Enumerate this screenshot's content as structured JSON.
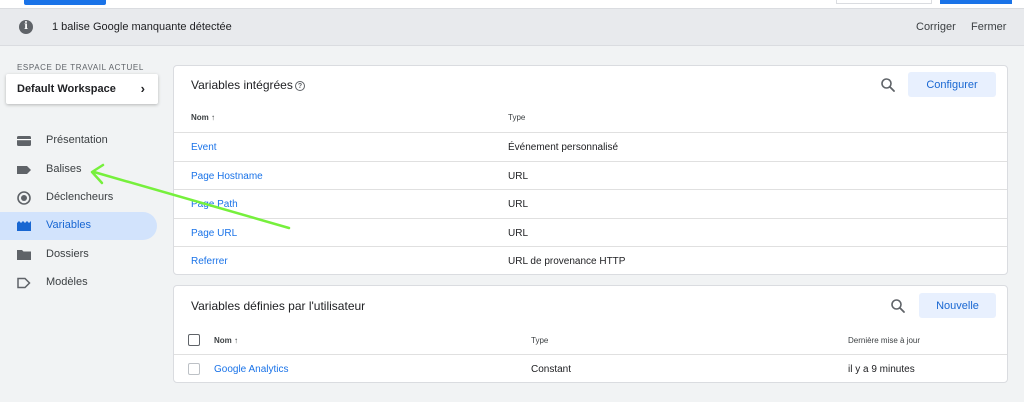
{
  "notification": {
    "message": "1 balise Google manquante détectée",
    "fix_label": "Corriger",
    "close_label": "Fermer"
  },
  "workspace": {
    "section_label": "ESPACE DE TRAVAIL ACTUEL",
    "name": "Default Workspace"
  },
  "sidebar": {
    "items": [
      {
        "label": "Présentation",
        "icon": "overview-icon"
      },
      {
        "label": "Balises",
        "icon": "tag-icon"
      },
      {
        "label": "Déclencheurs",
        "icon": "trigger-icon"
      },
      {
        "label": "Variables",
        "icon": "variables-icon",
        "active": true
      },
      {
        "label": "Dossiers",
        "icon": "folder-icon"
      },
      {
        "label": "Modèles",
        "icon": "template-icon"
      }
    ]
  },
  "builtin": {
    "title": "Variables intégrées",
    "configure_label": "Configurer",
    "columns": {
      "name": "Nom",
      "sort_arrow": "↑",
      "type": "Type"
    },
    "rows": [
      {
        "name": "Event",
        "type": "Événement personnalisé"
      },
      {
        "name": "Page Hostname",
        "type": "URL"
      },
      {
        "name": "Page Path",
        "type": "URL"
      },
      {
        "name": "Page URL",
        "type": "URL"
      },
      {
        "name": "Referrer",
        "type": "URL de provenance HTTP"
      }
    ]
  },
  "user_defined": {
    "title": "Variables définies par l'utilisateur",
    "new_label": "Nouvelle",
    "columns": {
      "name": "Nom",
      "sort_arrow": "↑",
      "type": "Type",
      "last_edited": "Dernière mise à jour"
    },
    "rows": [
      {
        "name": "Google Analytics",
        "type": "Constant",
        "last_edited": "il y a 9 minutes"
      }
    ]
  },
  "colors": {
    "accent": "#1a73e8",
    "active_nav_bg": "#d2e3fc",
    "annotation_arrow": "#76f03c"
  }
}
